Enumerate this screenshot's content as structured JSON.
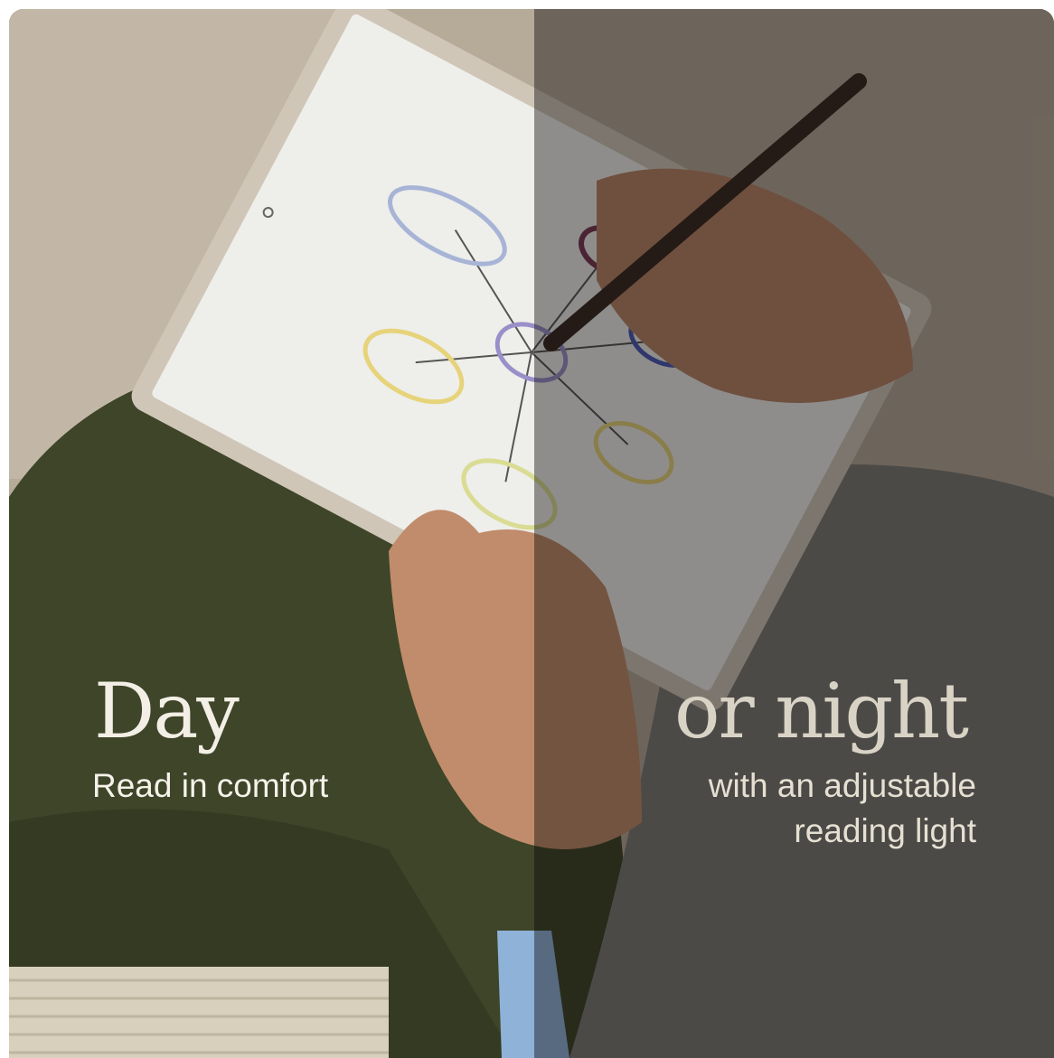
{
  "day": {
    "headline": "Day",
    "subtitle": "Read in comfort"
  },
  "night": {
    "headline": "or night",
    "subtitle_line1": "with an adjustable",
    "subtitle_line2": "reading light"
  },
  "colors": {
    "headline_day": "#f3efe6",
    "headline_night": "#d9d3c6",
    "pants": "#3e4528",
    "tablet_frame": "#cfc6b8",
    "screen": "#eeeeea",
    "night_overlay": "#0a0806"
  }
}
